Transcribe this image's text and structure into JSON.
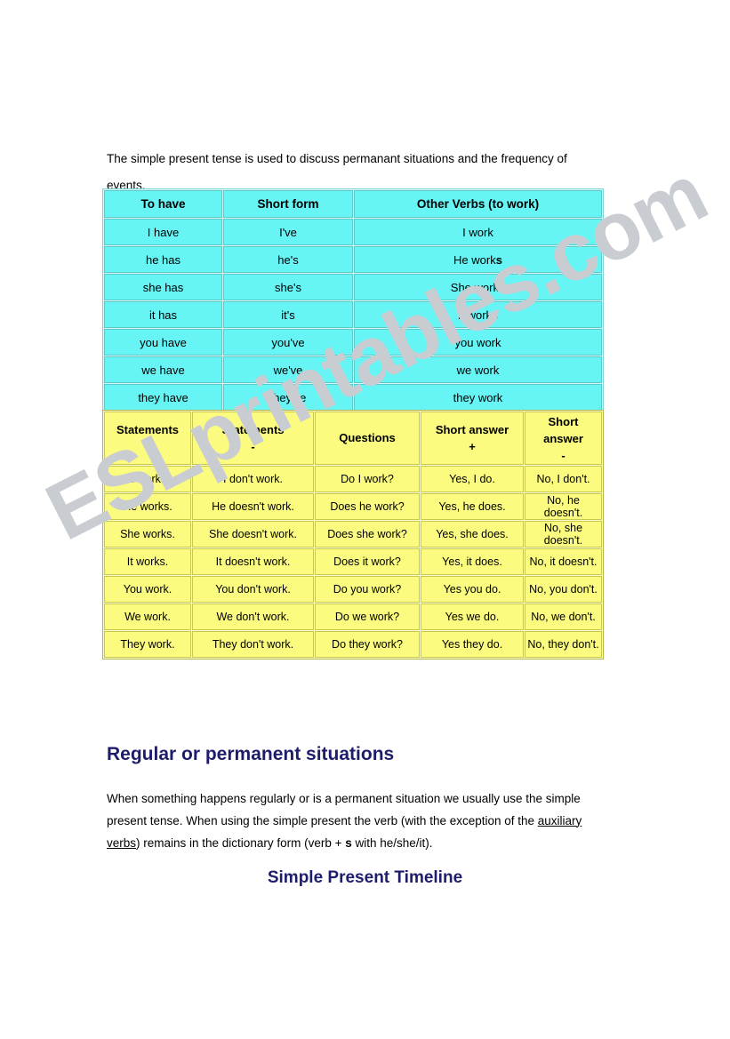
{
  "intro": {
    "paragraph": "The simple present tense is used to discuss permanant situations and the frequency of events."
  },
  "have_table": {
    "headers": [
      "To have",
      "Short form",
      "Other Verbs (to work)"
    ],
    "rows": [
      {
        "to_have": "I have",
        "short_form": "I've",
        "other_verb_stem": "I work",
        "other_verb_s": ""
      },
      {
        "to_have": "he has",
        "short_form": "he's",
        "other_verb_stem": "He work",
        "other_verb_s": "s"
      },
      {
        "to_have": "she has",
        "short_form": "she's",
        "other_verb_stem": "She work",
        "other_verb_s": "s"
      },
      {
        "to_have": "it has",
        "short_form": "it's",
        "other_verb_stem": "It work",
        "other_verb_s": "s"
      },
      {
        "to_have": "you have",
        "short_form": "you've",
        "other_verb_stem": "you work",
        "other_verb_s": ""
      },
      {
        "to_have": "we have",
        "short_form": "we've",
        "other_verb_stem": "we work",
        "other_verb_s": ""
      },
      {
        "to_have": "they have",
        "short_form": "they've",
        "other_verb_stem": "they work",
        "other_verb_s": ""
      }
    ]
  },
  "forms_table": {
    "headers": [
      {
        "label": "Statements",
        "sign": "+"
      },
      {
        "label": "Statements",
        "sign": "-"
      },
      {
        "label": "Questions",
        "sign": ""
      },
      {
        "label": "Short answer",
        "sign": "+"
      },
      {
        "label": "Short answer",
        "sign": "-"
      }
    ],
    "rows": [
      [
        "I work.",
        "I don't work.",
        "Do I work?",
        "Yes, I do.",
        "No, I don't."
      ],
      [
        "He works.",
        "He doesn't work.",
        "Does he work?",
        "Yes, he does.",
        "No, he doesn't."
      ],
      [
        "She works.",
        "She doesn't work.",
        "Does she work?",
        "Yes, she does.",
        "No, she doesn't."
      ],
      [
        "It works.",
        "It doesn't work.",
        "Does it work?",
        "Yes, it does.",
        "No, it doesn't."
      ],
      [
        "You work.",
        "You don't work.",
        "Do you work?",
        "Yes you do.",
        "No, you don't."
      ],
      [
        "We work.",
        "We don't work.",
        "Do we work?",
        "Yes we do.",
        "No, we don't."
      ],
      [
        "They work.",
        "They don't work.",
        "Do they work?",
        "Yes they do.",
        "No, they don't."
      ]
    ]
  },
  "section": {
    "heading": "Regular or permanent situations",
    "body_part1": "When something happens regularly or is a permanent situation we usually use the simple present tense. When using the simple present the verb (with the exception of the ",
    "body_link": "auxiliary verbs",
    "body_part2": ") remains in the dictionary form (verb + ",
    "body_bold_s": "s",
    "body_part3": " with he/she/it)."
  },
  "timeline": {
    "heading": "Simple Present Timeline"
  },
  "watermark": {
    "text": "ESLprintables.com",
    "color": "#c9cdd2"
  },
  "colors": {
    "cyan_cell": "#66f4f4",
    "cyan_border": "#59c9c9",
    "yellow_cell": "#fbfb80",
    "yellow_border": "#c8c84f",
    "heading_navy": "#1d1d6b"
  }
}
